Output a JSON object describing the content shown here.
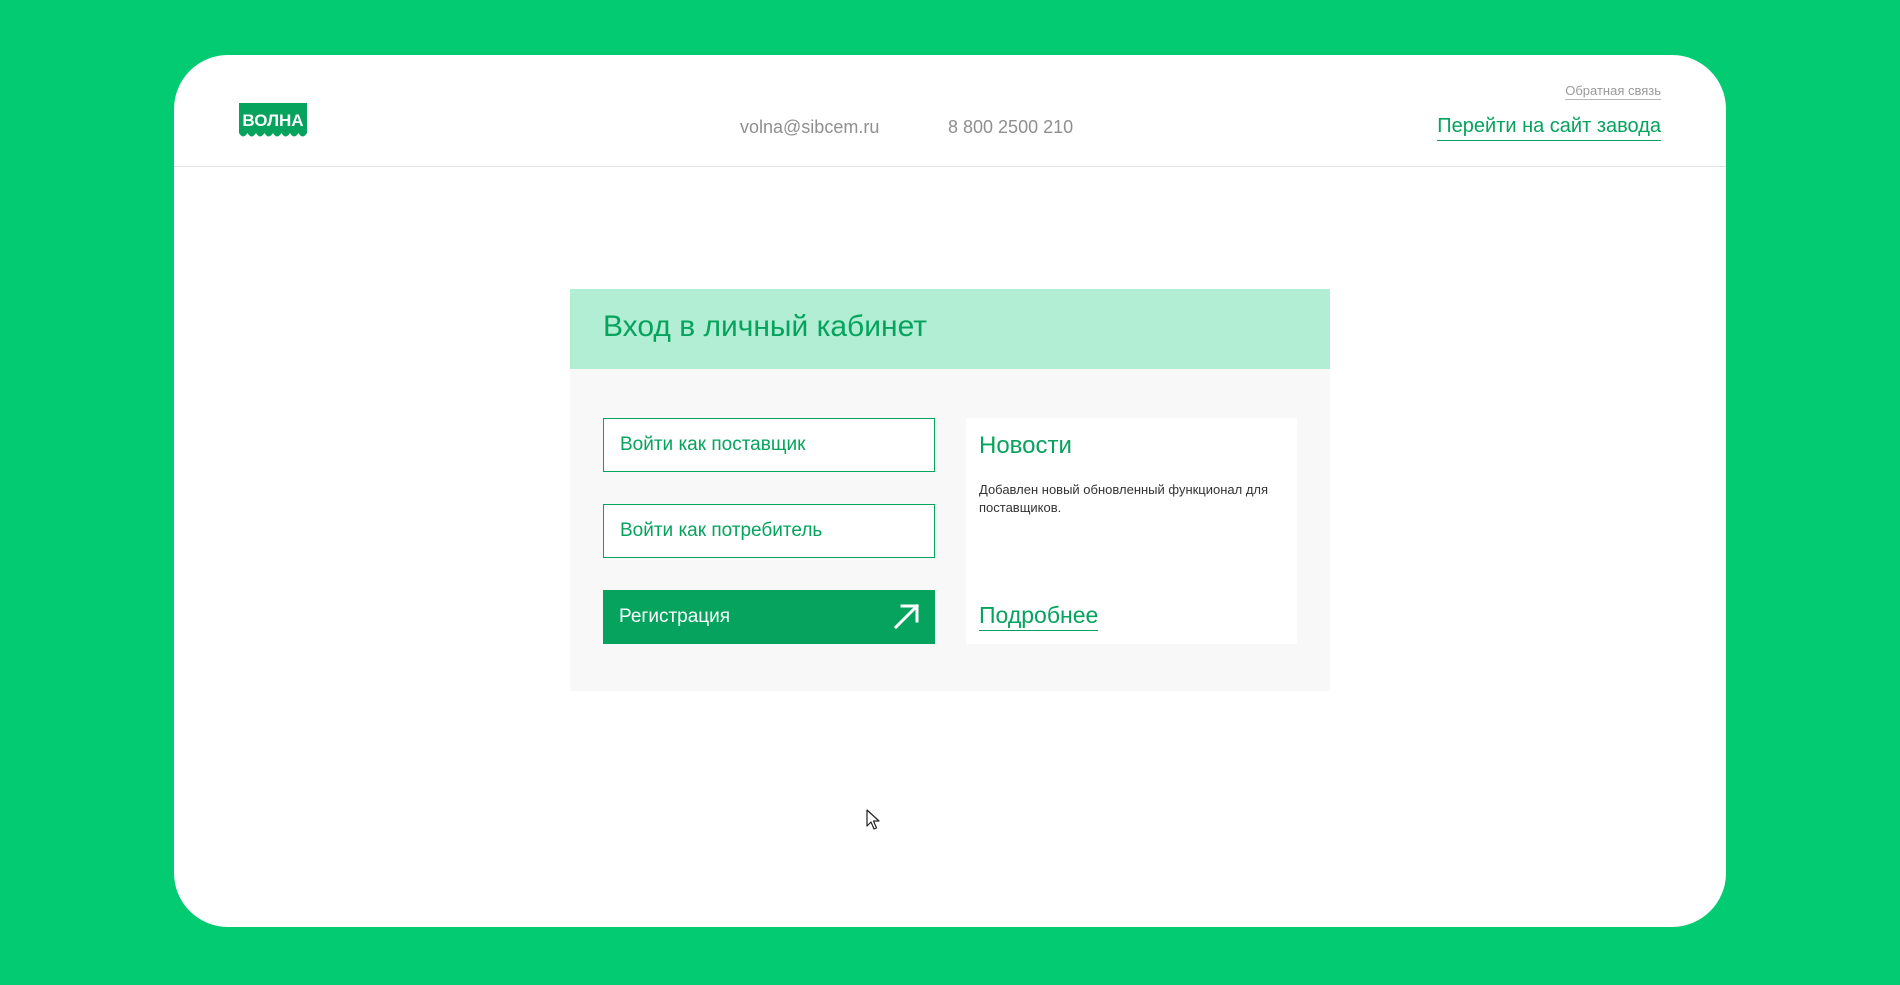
{
  "colors": {
    "page_bg": "#03cb72",
    "brand_green": "#05a35d",
    "header_band": "#b1eed3",
    "card_body": "#f8f8f8",
    "muted_text": "#8f8f8f"
  },
  "header": {
    "logo_text": "ВОЛНА",
    "email": "volna@sibcem.ru",
    "phone": "8 800 2500 210",
    "feedback_link": "Обратная связь",
    "factory_link": "Перейти на сайт завода"
  },
  "login": {
    "title": "Вход в личный кабинет",
    "supplier_button": "Войти как поставщик",
    "consumer_button": "Войти как потребитель",
    "register_button": "Регистрация",
    "register_icon": "arrow-up-right-icon"
  },
  "news": {
    "title": "Новости",
    "text": "Добавлен новый обновленный функционал для поставщиков.",
    "more_link": "Подробнее"
  }
}
